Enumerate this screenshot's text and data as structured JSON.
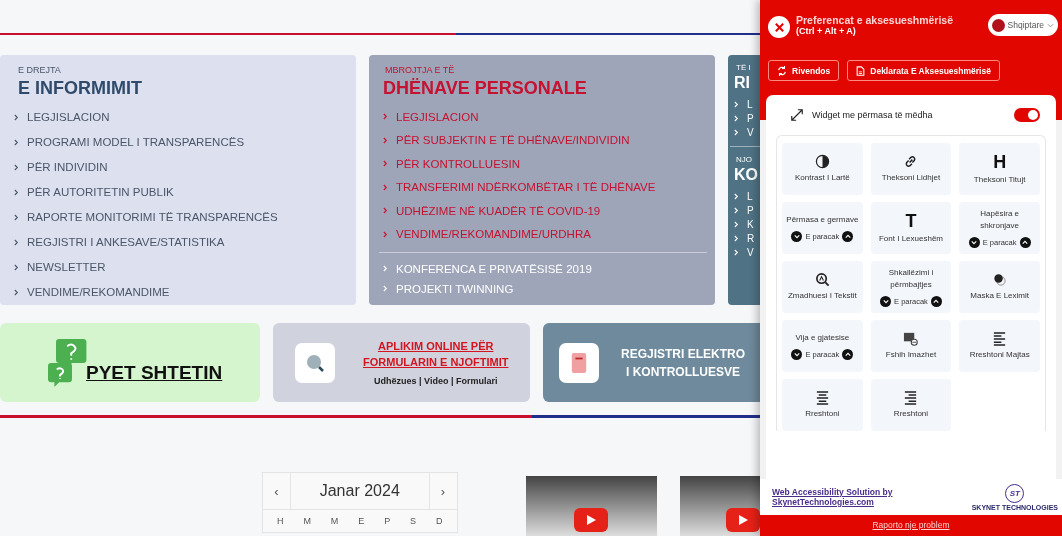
{
  "cards": [
    {
      "kind": "light",
      "sections": [
        {
          "kind": "primary",
          "kicker": "E DREJTA",
          "title": "E INFORMIMIT",
          "items": [
            "LEGJISLACION",
            "PROGRAMI MODEL I TRANSPARENCËS",
            "PËR INDIVIDIN",
            "PËR AUTORITETIN PUBLIK",
            "RAPORTE MONITORIMI TË TRANSPARENCËS",
            "REGJISTRI I ANKESAVE/STATISTIKA",
            "NEWSLETTER",
            "VENDIME/REKOMANDIME"
          ]
        }
      ]
    },
    {
      "kind": "grey",
      "sections": [
        {
          "kind": "primary",
          "kicker": "MBROJTJA E TË",
          "title": "DHËNAVE PERSONALE",
          "items": [
            "LEGJISLACION",
            "PËR SUBJEKTIN E TË DHËNAVE/INDIVIDIN",
            "PËR KONTROLLUESIN",
            "TRANSFERIMI NDËRKOMBËTAR I TË DHËNAVE",
            "UDHËZIME NË KUADËR TË COVID-19",
            "VENDIME/REKOMANDIME/URDHRA"
          ]
        },
        {
          "kind": "secondary",
          "items": [
            "KONFERENCA E PRIVATËSISË 2019",
            "PROJEKTI TWINNING"
          ]
        }
      ]
    },
    {
      "kind": "dark",
      "sections": [
        {
          "kind": "primary",
          "kicker": "TË I",
          "title": "RI",
          "items": [
            "L",
            "P",
            "V"
          ]
        },
        {
          "kind": "primary",
          "kicker": "NJO",
          "title": "KO",
          "items": [
            "L",
            "P",
            "K",
            "R",
            "V"
          ]
        }
      ]
    }
  ],
  "banners": [
    {
      "kind": "ask",
      "title": "PYET SHTETIN"
    },
    {
      "kind": "apply",
      "title": "APLIKIM ONLINE PËR",
      "title2": "FORMULARIN E NJOFTIMIT",
      "links": "Udhëzues | Video | Formulari"
    },
    {
      "kind": "register",
      "title": "REGJISTRI ELEKTRO",
      "title2": "I KONTROLLUESVE"
    }
  ],
  "calendar": {
    "prev": "‹",
    "month": "Janar 2024",
    "next": "›",
    "days": [
      "H",
      "M",
      "M",
      "E",
      "P",
      "S",
      "D"
    ]
  },
  "panel": {
    "title": "Preferencat e aksesueshmërisë",
    "shortcut": "(Ctrl + Alt + A)",
    "language": "Shqiptare",
    "buttons": [
      {
        "kind": "reset",
        "label": "Rivendos"
      },
      {
        "kind": "statement",
        "label": "Deklarata E Aksesueshmërisë"
      }
    ],
    "large_widget": {
      "label": "Widget me përmasa të mëdha",
      "on": true
    },
    "tiles": [
      {
        "kind": "contrast",
        "label": "Kontrast I Lartë"
      },
      {
        "kind": "link",
        "label": "Theksoni Lidhjet"
      },
      {
        "kind": "glyph",
        "glyph": "H",
        "label": "Theksoni Titujt"
      },
      {
        "kind": "stepper",
        "label": "Përmasa e germave",
        "value": "E paracak"
      },
      {
        "kind": "glyph",
        "glyph": "T",
        "label": "Font I Lexueshëm"
      },
      {
        "kind": "stepper",
        "label": "Hapësira e shkronjave",
        "value": "E paracak"
      },
      {
        "kind": "magnifier",
        "label": "Zmadhuesi I Tekstit"
      },
      {
        "kind": "stepper",
        "label": "Shkallëzimi i përmbajtjes",
        "value": "E paracak"
      },
      {
        "kind": "mask",
        "label": "Maska E Leximit"
      },
      {
        "kind": "stepper",
        "label": "Vija e gjatesise",
        "value": "E paracak"
      },
      {
        "kind": "images",
        "label": "Fshih Imazhet"
      },
      {
        "kind": "alignleft",
        "label": "Rreshtoni Majtas"
      },
      {
        "kind": "aligncenter",
        "label": "Rreshtoni"
      },
      {
        "kind": "alignright",
        "label": "Rreshtoni"
      }
    ],
    "credit": "Web Accessibility Solution by SkynetTechnologies.com",
    "logo_mark": "ST",
    "logo_text": "SKYNET TECHNOLOGIES",
    "report": "Raporto nje problem"
  }
}
